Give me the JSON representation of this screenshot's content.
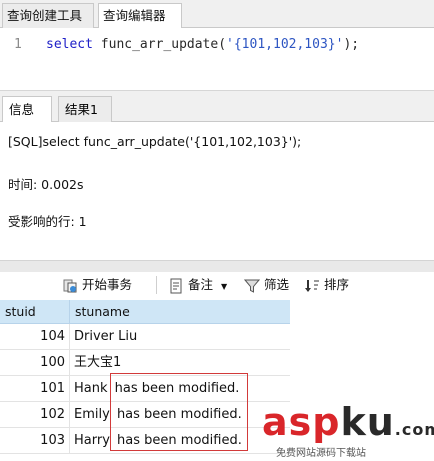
{
  "top_tabs": [
    "查询创建工具",
    "查询编辑器"
  ],
  "editor": {
    "line_number": "1",
    "keyword": "select",
    "function_name": "func_arr_update",
    "open_paren": "(",
    "argument": "'{101,102,103}'",
    "close": ");"
  },
  "panel_tabs": [
    "信息",
    "结果1"
  ],
  "info": {
    "sql_line": "[SQL]select func_arr_update('{101,102,103}');",
    "time_line": "时间: 0.002s",
    "affected_line": "受影响的行: 1"
  },
  "toolbar": {
    "begin_transaction": "开始事务",
    "note": "备注",
    "filter": "筛选",
    "sort": "排序"
  },
  "grid": {
    "columns": [
      "stuid",
      "stuname"
    ],
    "rows": [
      {
        "stuid": "104",
        "stuname": "Driver Liu",
        "suffix": ""
      },
      {
        "stuid": "100",
        "stuname": "王大宝1",
        "suffix": ""
      },
      {
        "stuid": "101",
        "stuname": "Hank",
        "suffix": "has been modified."
      },
      {
        "stuid": "102",
        "stuname": "Emily",
        "suffix": "has been modified."
      },
      {
        "stuid": "103",
        "stuname": "Harry",
        "suffix": "has been modified."
      }
    ]
  },
  "watermark": {
    "logo_a": "asp",
    "logo_b": "ku",
    "logo_dot": ".com",
    "subtitle": "免费网站源码下载站"
  },
  "colors": {
    "keyword": "#1f20c8",
    "string": "#2d55c2",
    "grid_header": "#cfe6f6",
    "highlight_box": "#d23a3a",
    "watermark_red": "#d9262a"
  }
}
